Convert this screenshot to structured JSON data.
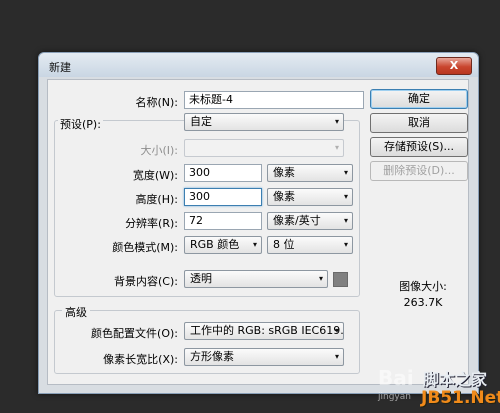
{
  "dialog": {
    "title": "新建",
    "close_label": "X"
  },
  "form": {
    "name_label": "名称(N):",
    "name_value": "未标题-4",
    "preset_label": "预设(P):",
    "preset_value": "自定",
    "size_label": "大小(I):",
    "width_label": "宽度(W):",
    "width_value": "300",
    "width_unit": "像素",
    "height_label": "高度(H):",
    "height_value": "300",
    "height_unit": "像素",
    "resolution_label": "分辨率(R):",
    "resolution_value": "72",
    "resolution_unit": "像素/英寸",
    "color_mode_label": "颜色模式(M):",
    "color_mode_value": "RGB 颜色",
    "bit_depth_value": "8 位",
    "background_label": "背景内容(C):",
    "background_value": "透明",
    "background_swatch_color": "#808080"
  },
  "advanced": {
    "heading": "高级",
    "color_profile_label": "颜色配置文件(O):",
    "color_profile_value": "工作中的 RGB: sRGB IEC619...",
    "pixel_aspect_label": "像素长宽比(X):",
    "pixel_aspect_value": "方形像素"
  },
  "buttons": {
    "ok": "确定",
    "cancel": "取消",
    "save_preset": "存储预设(S)...",
    "delete_preset": "删除预设(D)..."
  },
  "image_size": {
    "label": "图像大小:",
    "value": "263.7K"
  },
  "watermarks": {
    "baidu": "Bai",
    "site_cn": "脚本之家",
    "site_domain": "JB51.Net",
    "site_sub": "jingyan"
  },
  "icons": {
    "dropdown": "chevron-down-icon"
  }
}
